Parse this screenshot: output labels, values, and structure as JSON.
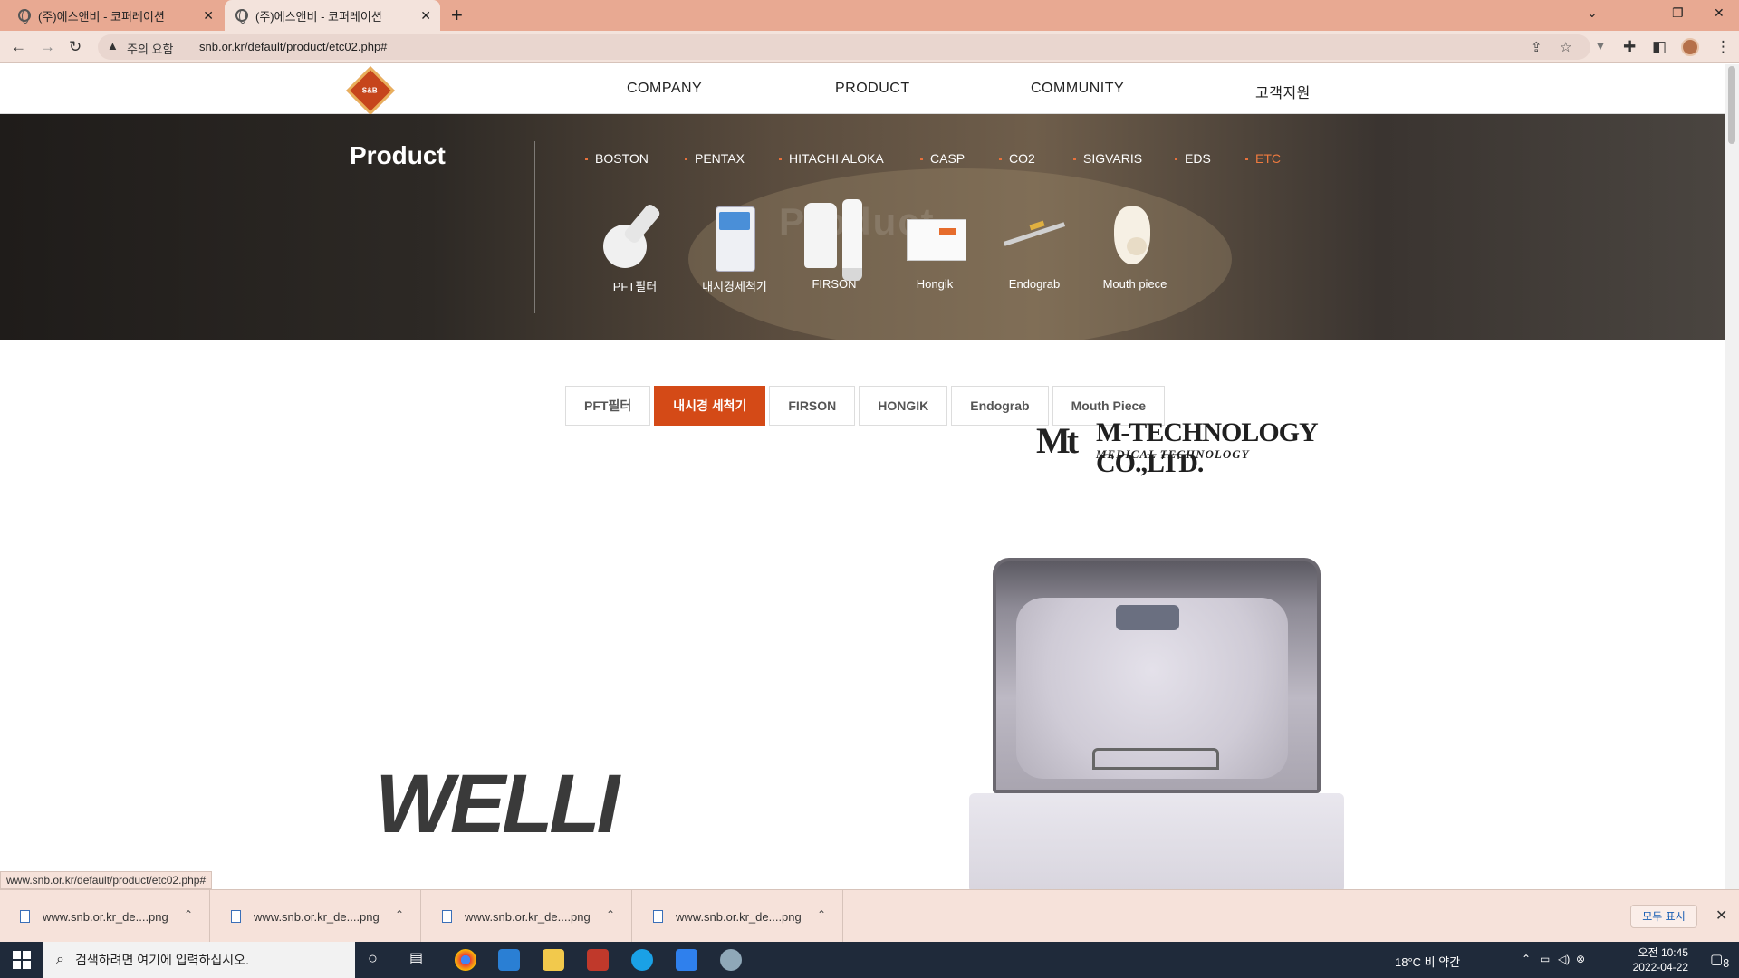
{
  "browser": {
    "tabs": [
      {
        "title": "(주)에스앤비 - 코퍼레이션",
        "active": false
      },
      {
        "title": "(주)에스앤비 - 코퍼레이션",
        "active": true
      }
    ],
    "security_label": "주의 요함",
    "url": "snb.or.kr/default/product/etc02.php#",
    "status_url": "www.snb.or.kr/default/product/etc02.php#"
  },
  "site": {
    "logo_text": "S&B",
    "nav": [
      "COMPANY",
      "PRODUCT",
      "COMMUNITY",
      "고객지원"
    ]
  },
  "hero": {
    "title": "Product",
    "watermark": "Product",
    "brands": [
      {
        "label": "BOSTON",
        "active": false
      },
      {
        "label": "PENTAX",
        "active": false
      },
      {
        "label": "HITACHI ALOKA",
        "active": false
      },
      {
        "label": "CASP",
        "active": false
      },
      {
        "label": "CO2",
        "active": false
      },
      {
        "label": "SIGVARIS",
        "active": false
      },
      {
        "label": "EDS",
        "active": false
      },
      {
        "label": "ETC",
        "active": true
      }
    ],
    "products": [
      {
        "label": "PFT필터",
        "icon": "pft-filter-icon"
      },
      {
        "label": "내시경세척기",
        "icon": "endoscope-washer-icon"
      },
      {
        "label": "FIRSON",
        "icon": "firson-bottles-icon"
      },
      {
        "label": "Hongik",
        "icon": "hongik-device-icon"
      },
      {
        "label": "Endograb",
        "icon": "endograb-tool-icon"
      },
      {
        "label": "Mouth piece",
        "icon": "mouth-piece-icon"
      }
    ]
  },
  "product_tabs": [
    {
      "label": "PFT필터",
      "active": false
    },
    {
      "label": "내시경 세척기",
      "active": true
    },
    {
      "label": "FIRSON",
      "active": false
    },
    {
      "label": "HONGIK",
      "active": false
    },
    {
      "label": "Endograb",
      "active": false
    },
    {
      "label": "Mouth Piece",
      "active": false
    }
  ],
  "content": {
    "brand_mark": "Mt",
    "brand_name": "M-TECHNOLOGY CO.,LTD.",
    "brand_sub": "MEDICAL TECHNOLOGY",
    "product_logo": "WELLI"
  },
  "downloads": {
    "items": [
      "www.snb.or.kr_de....png",
      "www.snb.or.kr_de....png",
      "www.snb.or.kr_de....png",
      "www.snb.or.kr_de....png"
    ],
    "show_all": "모두 표시"
  },
  "taskbar": {
    "search_placeholder": "검색하려면 여기에 입력하십시오.",
    "weather": "18°C  비 약간",
    "time": "오전 10:45",
    "date": "2022-04-22",
    "notification_count": "8"
  },
  "colors": {
    "accent": "#d44a17",
    "chrome_frame": "#e8a992",
    "active_brand": "#ef7a3f"
  }
}
